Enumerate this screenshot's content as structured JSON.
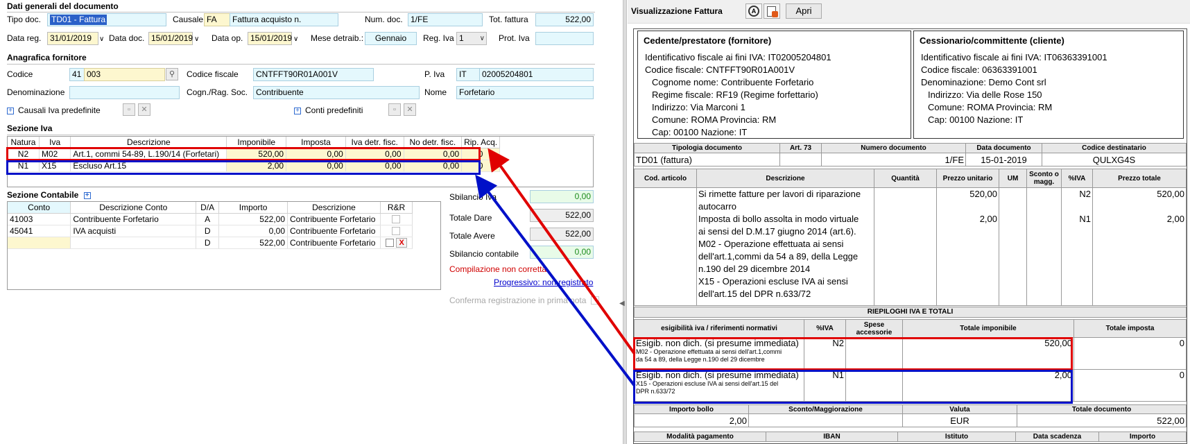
{
  "colors": {
    "field_bg": "#e4f8fd",
    "field_yellow": "#fdf7cf",
    "error_red": "#d00000",
    "link_blue": "#0000cc",
    "ok_green": "#1a8a1a",
    "annotation_red": "#e00000",
    "annotation_blue": "#0010c8"
  },
  "doc": {
    "title": "Dati generali del documento",
    "tipo_label": "Tipo doc.",
    "tipo_value": "TD01 - Fattura",
    "causale_label": "Causale",
    "causale_code": "FA",
    "causale_desc": "Fattura acquisto n.",
    "numdoc_label": "Num. doc.",
    "numdoc_value": "1/FE",
    "totfatt_label": "Tot. fattura",
    "totfatt_value": "522,00",
    "datareg_label": "Data reg.",
    "datareg_value": "31/01/2019",
    "datadoc_label": "Data doc.",
    "datadoc_value": "15/01/2019",
    "dataop_label": "Data op.",
    "dataop_value": "15/01/2019",
    "mese_label": "Mese detraib.:",
    "mese_value": "Gennaio",
    "regiva_label": "Reg. Iva",
    "regiva_value": "1",
    "protiva_label": "Prot. Iva",
    "protiva_value": ""
  },
  "supplier": {
    "title": "Anagrafica fornitore",
    "codice_label": "Codice",
    "codice_prefix": "41",
    "codice_value": "003",
    "cf_label": "Codice fiscale",
    "cf_value": "CNTFFT90R01A001V",
    "piva_label": "P. Iva",
    "piva_country": "IT",
    "piva_value": "02005204801",
    "denom_label": "Denominazione",
    "denom_value": "",
    "cognome_label": "Cogn./Rag. Soc.",
    "cognome_value": "Contribuente",
    "nome_label": "Nome",
    "nome_value": "Forfetario",
    "causali_label": "Causali Iva predefinite",
    "conti_label": "Conti predefiniti",
    "plus_glyph": "+"
  },
  "iva": {
    "title": "Sezione Iva",
    "headers": [
      "Natura",
      "Iva",
      "Descrizione",
      "Imponibile",
      "Imposta",
      "Iva detr. fisc.",
      "No detr. fisc.",
      "Rip. Acq."
    ],
    "rows": [
      [
        "N2",
        "M02",
        "Art.1, commi 54-89, L.190/14 (Forfetari)",
        "520,00",
        "0,00",
        "0,00",
        "0,00",
        "0"
      ],
      [
        "N1",
        "X15",
        "Escluso Art.15",
        "2,00",
        "0,00",
        "0,00",
        "0,00",
        "0"
      ]
    ]
  },
  "contabile": {
    "title": "Sezione Contabile",
    "headers": [
      "Conto",
      "Descrizione Conto",
      "D/A",
      "Importo",
      "Descrizione",
      "R&R"
    ],
    "rows": [
      [
        "41003",
        "Contribuente Forfetario",
        "A",
        "522,00",
        "Contribuente Forfetario"
      ],
      [
        "45041",
        "IVA acquisti",
        "D",
        "0,00",
        "Contribuente Forfetario"
      ],
      [
        "",
        "",
        "D",
        "522,00",
        "Contribuente Forfetario"
      ]
    ],
    "delete_glyph": "X"
  },
  "totals": {
    "sbil_iva_label": "Sbilancio Iva",
    "sbil_iva_value": "0,00",
    "dare_label": "Totale Dare",
    "dare_value": "522,00",
    "avere_label": "Totale Avere",
    "avere_value": "522,00",
    "sbil_cont_label": "Sbilancio contabile",
    "sbil_cont_value": "0,00",
    "error_msg": "Compilazione non corretta",
    "progressivo": "Progressivo: non registrato",
    "conferma_label": "Conferma registrazione in prima nota"
  },
  "viewer": {
    "title": "Visualizzazione Fattura",
    "open_button": "Apri",
    "icon_a": "A"
  },
  "invoice": {
    "cedente": {
      "title": "Cedente/prestatore (fornitore)",
      "lines": [
        "Identificativo fiscale ai fini IVA: IT02005204801",
        "Codice fiscale: CNTFFT90R01A001V",
        "Cognome nome: Contribuente Forfetario",
        "Regime fiscale: RF19 (Regime forfettario)",
        "Indirizzo: Via Marconi 1",
        "Comune: ROMA Provincia: RM",
        "Cap: 00100 Nazione: IT"
      ]
    },
    "cessionario": {
      "title": "Cessionario/committente (cliente)",
      "lines": [
        "Identificativo fiscale ai fini IVA: IT06363391001",
        "Codice fiscale: 06363391001",
        "Denominazione: Demo Cont srl",
        "Indirizzo: Via delle Rose 150",
        "Comune: ROMA Provincia: RM",
        "Cap: 00100 Nazione: IT"
      ]
    },
    "doc_headers": [
      "Tipologia documento",
      "Art. 73",
      "Numero documento",
      "Data documento",
      "Codice destinatario"
    ],
    "doc_values": [
      "TD01 (fattura)",
      "",
      "1/FE",
      "15-01-2019",
      "QULXG4S"
    ],
    "item_headers": [
      "Cod. articolo",
      "Descrizione",
      "Quantità",
      "Prezzo unitario",
      "UM",
      "Sconto o magg.",
      "%IVA",
      "Prezzo totale"
    ],
    "items": [
      {
        "desc": [
          "Si rimette fatture per lavori di riparazione",
          "autocarro"
        ],
        "unit": "520,00",
        "iva": "N2",
        "total": "520,00"
      },
      {
        "desc": [
          "Imposta di bollo assolta in modo virtuale",
          "ai sensi del D.M.17 giugno 2014 (art.6)."
        ],
        "unit": "2,00",
        "iva": "N1",
        "total": "2,00"
      },
      {
        "desc": [
          "M02 - Operazione effettuata ai sensi",
          "dell'art.1,commi da 54 a 89, della Legge",
          "n.190 del 29 dicembre 2014"
        ],
        "unit": "",
        "iva": "",
        "total": ""
      },
      {
        "desc": [
          "X15 - Operazioni escluse IVA ai sensi",
          "dell'art.15 del DPR n.633/72"
        ],
        "unit": "",
        "iva": "",
        "total": ""
      }
    ],
    "riepilogo_title": "RIEPILOGHI IVA E TOTALI",
    "riep_headers": [
      "esigibilità iva / riferimenti normativi",
      "%IVA",
      "Spese accessorie",
      "Totale imponibile",
      "Totale imposta"
    ],
    "riep_rows": [
      {
        "esig": "Esigib. non dich. (si presume immediata)",
        "note": [
          "M02 - Operazione effettuata ai sensi dell'art.1,commi",
          "da 54 a 89, della Legge n.190 del 29 dicembre"
        ],
        "iva": "N2",
        "imponibile": "520,00",
        "imposta": "0"
      },
      {
        "esig": "Esigib. non dich. (si presume immediata)",
        "note": [
          "X15 - Operazioni escluse IVA ai sensi dell'art.15 del",
          "DPR n.633/72"
        ],
        "iva": "N1",
        "imponibile": "2,00",
        "imposta": "0"
      }
    ],
    "tot_headers": [
      "Importo bollo",
      "Sconto/Maggiorazione",
      "Valuta",
      "Totale documento"
    ],
    "tot_values": [
      "2,00",
      "",
      "EUR",
      "522,00"
    ],
    "pay_headers": [
      "Modalità pagamento",
      "IBAN",
      "Istituto",
      "Data scadenza",
      "Importo"
    ]
  }
}
